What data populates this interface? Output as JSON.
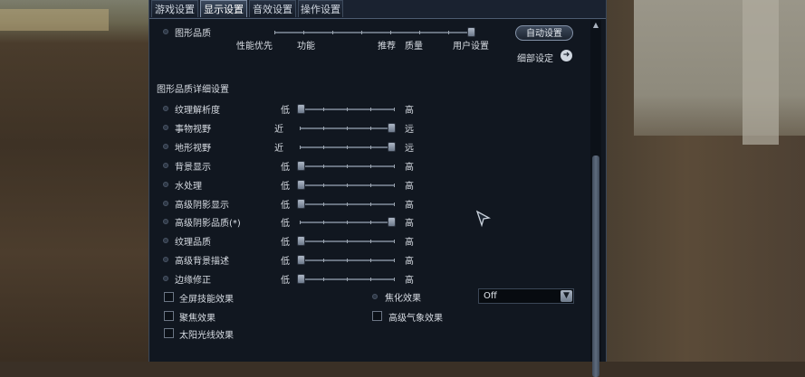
{
  "tabs": [
    {
      "label": "游戏设置"
    },
    {
      "label": "显示设置"
    },
    {
      "label": "音效设置"
    },
    {
      "label": "操作设置"
    }
  ],
  "graphics_quality": {
    "label": "图形品质",
    "marks": [
      "性能优先",
      "功能",
      "推荐",
      "质量",
      "用户设置"
    ],
    "auto_button": "自动设置",
    "detail_link": "细部设定"
  },
  "detail_section": {
    "title": "图形品质详细设置",
    "sliders": [
      {
        "label": "纹理解析度",
        "min": "低",
        "max": "高",
        "level": 0.0
      },
      {
        "label": "事物视野",
        "min": "近",
        "max": "远",
        "level": 1.0
      },
      {
        "label": "地形视野",
        "min": "近",
        "max": "远",
        "level": 1.0
      },
      {
        "label": "背景显示",
        "min": "低",
        "max": "高",
        "level": 0.0
      },
      {
        "label": "水处理",
        "min": "低",
        "max": "高",
        "level": 0.0
      },
      {
        "label": "高级阴影显示",
        "min": "低",
        "max": "高",
        "level": 0.0
      },
      {
        "label": "高级阴影品质(*)",
        "min": "低",
        "max": "高",
        "level": 1.0
      },
      {
        "label": "纹理品质",
        "min": "低",
        "max": "高",
        "level": 0.0
      },
      {
        "label": "高级背景描述",
        "min": "低",
        "max": "高",
        "level": 0.0
      },
      {
        "label": "边缘修正",
        "min": "低",
        "max": "高",
        "level": 0.0
      }
    ]
  },
  "effects": {
    "fullscreen_skill": "全屏技能效果",
    "focus": "聚焦效果",
    "sunlight": "太阳光线效果",
    "blur_label": "焦化效果",
    "blur_value": "Off",
    "advanced_weather": "高级气象效果"
  }
}
